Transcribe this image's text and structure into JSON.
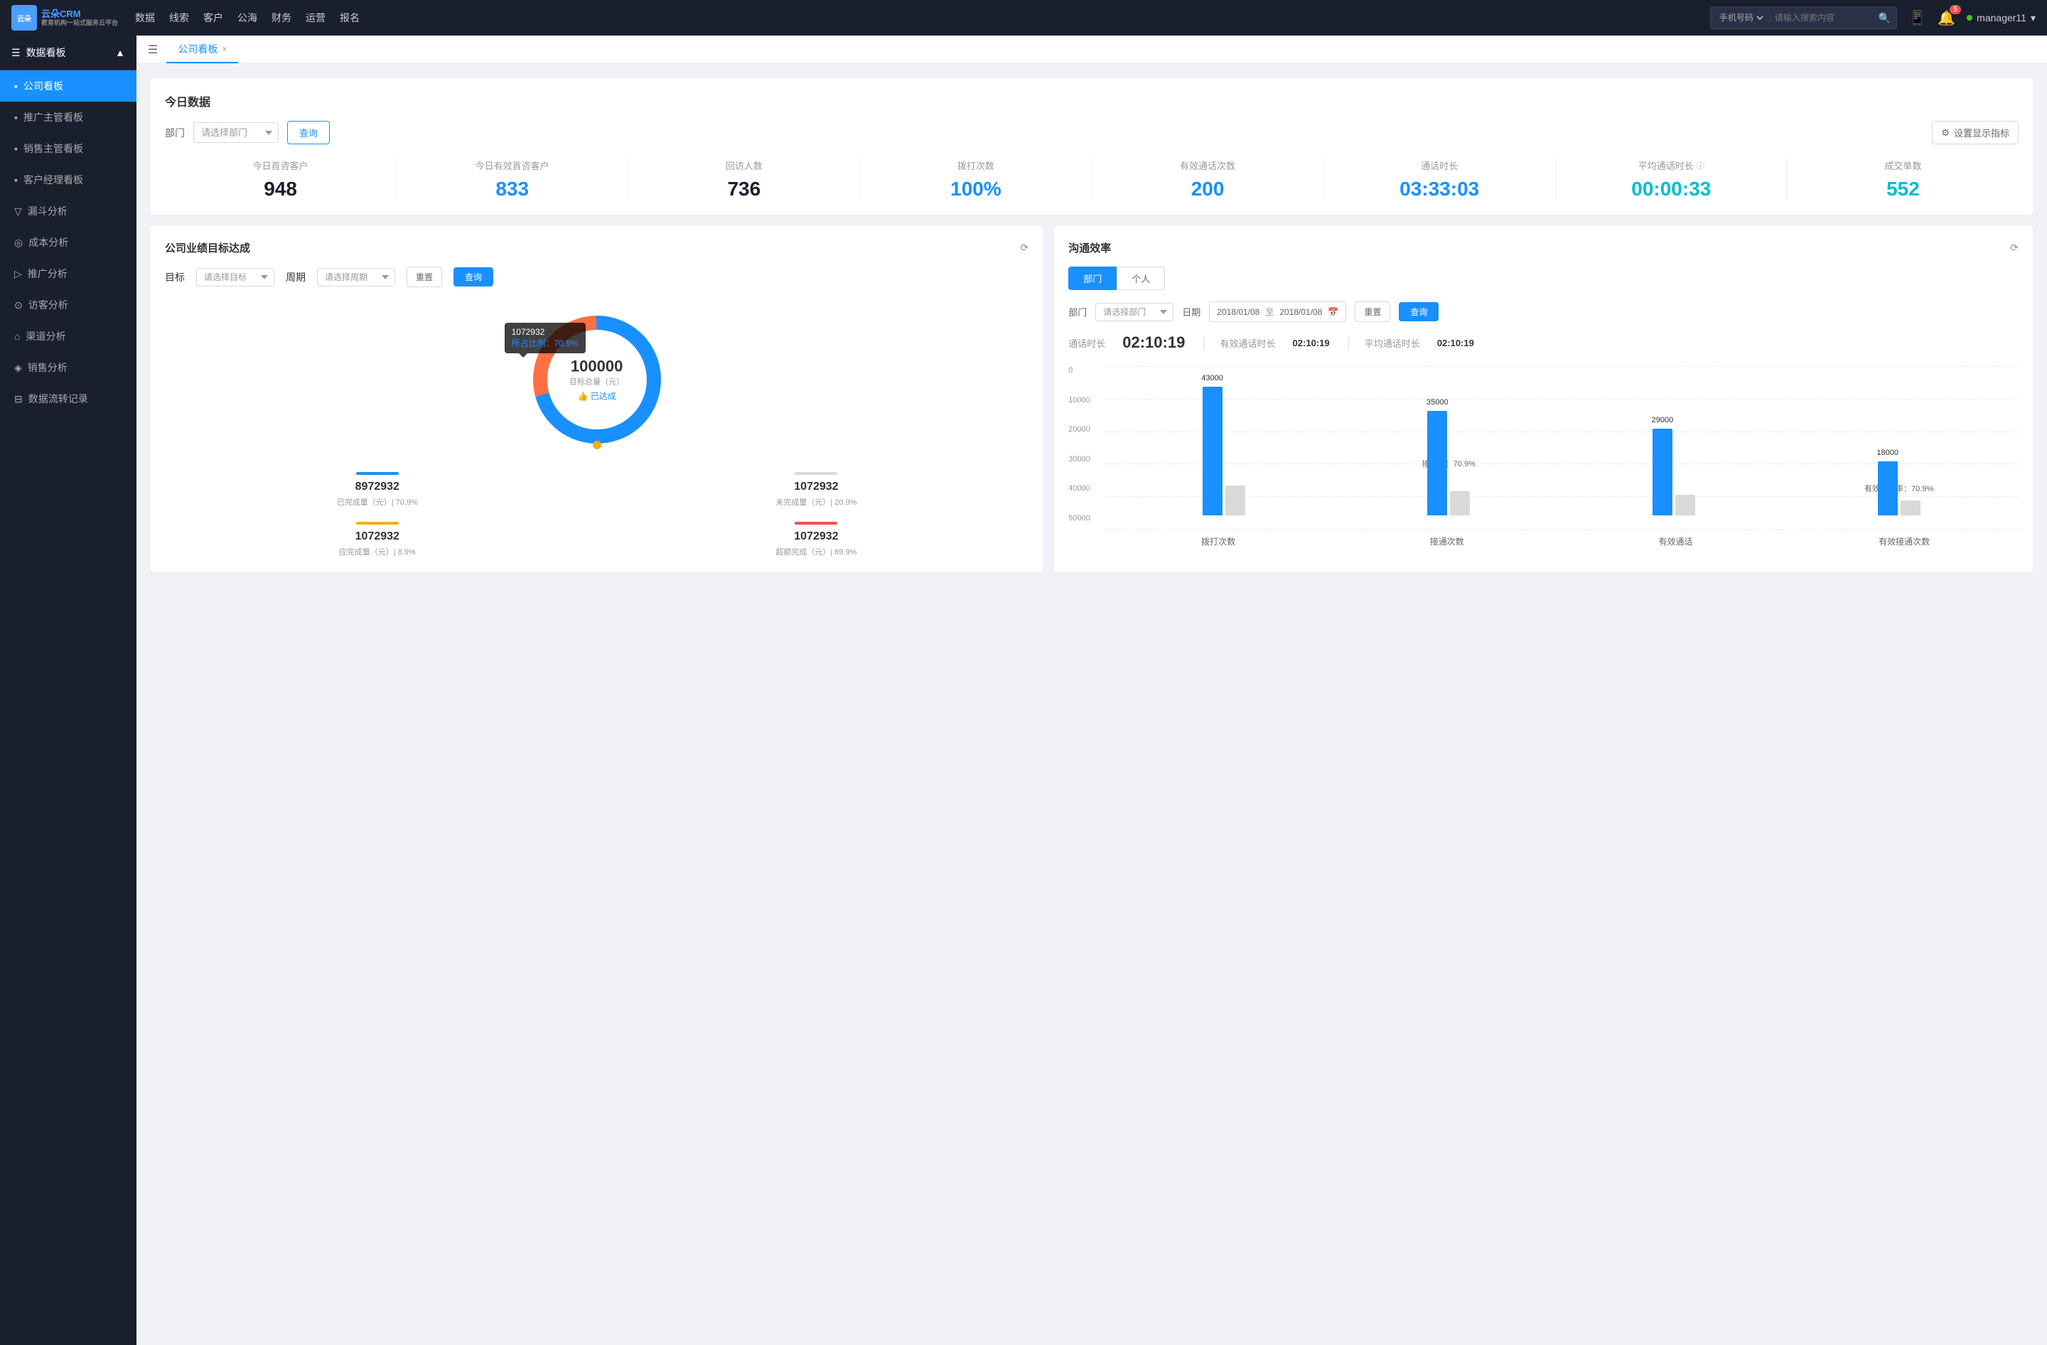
{
  "topNav": {
    "logo": "云朵CRM",
    "logoSub": "教育机构一站式服务云平台",
    "navItems": [
      "数据",
      "线索",
      "客户",
      "公海",
      "财务",
      "运营",
      "报名"
    ],
    "searchPlaceholder": "请输入搜索内容",
    "searchType": "手机号码",
    "notifBadge": "5",
    "user": "manager11"
  },
  "sidebar": {
    "mainSection": "数据看板",
    "items": [
      {
        "label": "公司看板",
        "icon": "▪",
        "active": true
      },
      {
        "label": "推广主管看板",
        "icon": "▪",
        "active": false
      },
      {
        "label": "销售主管看板",
        "icon": "▪",
        "active": false
      },
      {
        "label": "客户经理看板",
        "icon": "▪",
        "active": false
      },
      {
        "label": "漏斗分析",
        "icon": "▽",
        "active": false
      },
      {
        "label": "成本分析",
        "icon": "◎",
        "active": false
      },
      {
        "label": "推广分析",
        "icon": "▷",
        "active": false
      },
      {
        "label": "访客分析",
        "icon": "⊙",
        "active": false
      },
      {
        "label": "渠道分析",
        "icon": "⌂",
        "active": false
      },
      {
        "label": "销售分析",
        "icon": "◈",
        "active": false
      },
      {
        "label": "数据流转记录",
        "icon": "⊟",
        "active": false
      }
    ]
  },
  "tab": {
    "label": "公司看板",
    "close": "×"
  },
  "todayData": {
    "sectionTitle": "今日数据",
    "filterLabel": "部门",
    "filterPlaceholder": "请选择部门",
    "queryBtn": "查询",
    "settingsBtn": "设置显示指标",
    "stats": [
      {
        "label": "今日首咨客户",
        "value": "948",
        "color": "dark"
      },
      {
        "label": "今日有效首咨客户",
        "value": "833",
        "color": "blue"
      },
      {
        "label": "回访人数",
        "value": "736",
        "color": "dark"
      },
      {
        "label": "拨打次数",
        "value": "100%",
        "color": "blue"
      },
      {
        "label": "有效通话次数",
        "value": "200",
        "color": "blue"
      },
      {
        "label": "通话时长",
        "value": "03:33:03",
        "color": "blue"
      },
      {
        "label": "平均通话时长",
        "value": "00:00:33",
        "color": "cyan"
      },
      {
        "label": "成交单数",
        "value": "552",
        "color": "cyan"
      }
    ]
  },
  "performancePanel": {
    "title": "公司业绩目标达成",
    "targetLabel": "目标",
    "targetPlaceholder": "请选择目标",
    "periodLabel": "周期",
    "periodPlaceholder": "请选择周期",
    "resetBtn": "重置",
    "queryBtn": "查询",
    "donut": {
      "value": "100000",
      "label": "目标总量（元）",
      "sub": "👍 已达成",
      "tooltip": "1072932",
      "tooltipPercent": "所占比例：70.9%",
      "percent": 70.9
    },
    "metrics": [
      {
        "label": "已完成量（元）| 70.9%",
        "value": "8972932",
        "color": "blue"
      },
      {
        "label": "未完成量（元）| 20.9%",
        "value": "1072932",
        "color": "gray"
      },
      {
        "label": "应完成量（元）| 8.9%",
        "value": "1072932",
        "color": "orange"
      },
      {
        "label": "超额完成（元）| 89.9%",
        "value": "1072932",
        "color": "red"
      }
    ]
  },
  "commPanel": {
    "title": "沟通效率",
    "tabDept": "部门",
    "tabPerson": "个人",
    "deptLabel": "部门",
    "deptPlaceholder": "请选择部门",
    "dateLabel": "日期",
    "dateFrom": "2018/01/08",
    "dateTo": "2018/01/08",
    "resetBtn": "重置",
    "queryBtn": "查询",
    "stats": {
      "callTimeLabel": "通话时长",
      "callTime": "02:10:19",
      "effTimeLabel": "有效通话时长",
      "effTime": "02:10:19",
      "avgTimeLabel": "平均通话时长",
      "avgTime": "02:10:19"
    },
    "chart": {
      "yLabels": [
        "0",
        "10000",
        "20000",
        "30000",
        "40000",
        "50000"
      ],
      "groups": [
        {
          "label": "拨打次数",
          "bars": [
            {
              "value": 43000,
              "height": 180,
              "color": "blue",
              "label": "43000"
            },
            {
              "value": 10000,
              "height": 42,
              "color": "gray",
              "label": ""
            }
          ],
          "annotation": null
        },
        {
          "label": "接通次数",
          "bars": [
            {
              "value": 35000,
              "height": 146,
              "color": "blue",
              "label": "35000"
            },
            {
              "value": 8000,
              "height": 33,
              "color": "gray",
              "label": ""
            }
          ],
          "annotation": "接通率：70.9%"
        },
        {
          "label": "有效通话",
          "bars": [
            {
              "value": 29000,
              "height": 121,
              "color": "blue",
              "label": "29000"
            },
            {
              "value": 7000,
              "height": 29,
              "color": "gray",
              "label": ""
            }
          ],
          "annotation": null
        },
        {
          "label": "有效接通次数",
          "bars": [
            {
              "value": 18000,
              "height": 75,
              "color": "blue",
              "label": "18000"
            },
            {
              "value": 5000,
              "height": 21,
              "color": "gray",
              "label": ""
            }
          ],
          "annotation": "有效接通率：70.9%"
        }
      ]
    }
  }
}
